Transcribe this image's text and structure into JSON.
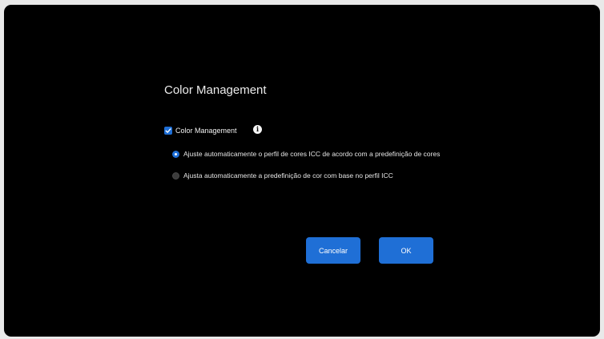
{
  "dialog": {
    "title": "Color Management"
  },
  "color_management": {
    "checkbox_label": "Color Management",
    "checked": true,
    "info_icon": "info-icon"
  },
  "options": [
    {
      "label": "Ajuste automaticamente o perfil de cores ICC de acordo com a predefinição de cores",
      "selected": true
    },
    {
      "label": "Ajusta automaticamente a predefinição de cor com base no perfil ICC",
      "selected": false
    }
  ],
  "buttons": {
    "cancel_label": "Cancelar",
    "ok_label": "OK"
  },
  "colors": {
    "accent": "#1f6fd6",
    "background": "#000000"
  }
}
